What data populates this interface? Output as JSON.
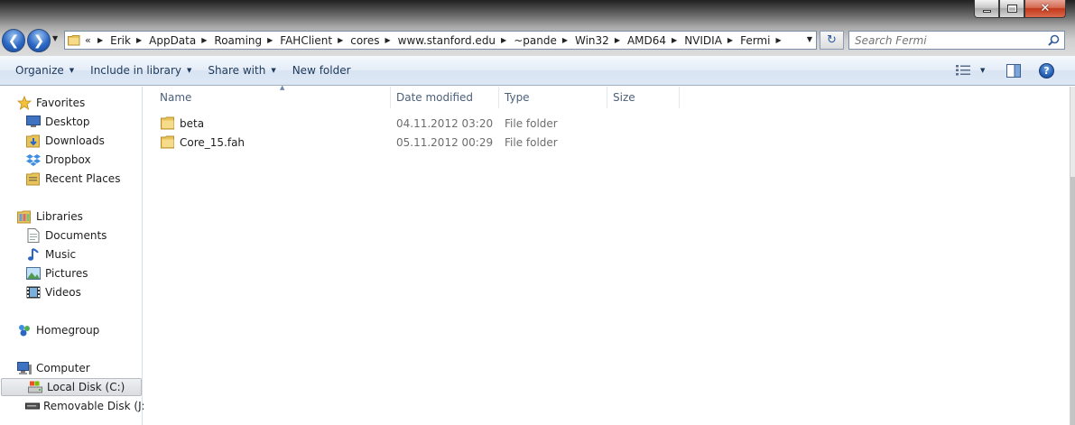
{
  "window": {
    "caption_buttons": {
      "minimize_icon": "minimize-icon",
      "maximize_icon": "maximize-icon",
      "close_icon": "close-icon",
      "close_glyph": "✕"
    }
  },
  "navigation": {
    "back_glyph": "❮",
    "forward_glyph": "❯",
    "history_glyph": "▼"
  },
  "address_bar": {
    "overflow_glyph": "«",
    "separator_glyph": "▶",
    "breadcrumbs": [
      "Erik",
      "AppData",
      "Roaming",
      "FAHClient",
      "cores",
      "www.stanford.edu",
      "~pande",
      "Win32",
      "AMD64",
      "NVIDIA",
      "Fermi"
    ],
    "dropdown_glyph": "▼",
    "refresh_glyph": "↻"
  },
  "search": {
    "placeholder": "Search Fermi"
  },
  "command_bar": {
    "organize": "Organize",
    "include_in_library": "Include in library",
    "share_with": "Share with",
    "new_folder": "New folder",
    "caret_glyph": "▼",
    "help_glyph": "?"
  },
  "nav_pane": {
    "favorites": {
      "label": "Favorites",
      "items": [
        "Desktop",
        "Downloads",
        "Dropbox",
        "Recent Places"
      ]
    },
    "libraries": {
      "label": "Libraries",
      "items": [
        "Documents",
        "Music",
        "Pictures",
        "Videos"
      ]
    },
    "homegroup": {
      "label": "Homegroup"
    },
    "computer": {
      "label": "Computer",
      "items": [
        "Local Disk (C:)",
        "Removable Disk (J:)"
      ],
      "selected": "Local Disk (C:)"
    }
  },
  "file_list": {
    "columns": [
      "Name",
      "Date modified",
      "Type",
      "Size"
    ],
    "sort_glyph": "▲",
    "rows": [
      {
        "name": "beta",
        "date_modified": "04.11.2012 03:20",
        "type": "File folder",
        "size": ""
      },
      {
        "name": "Core_15.fah",
        "date_modified": "05.11.2012 00:29",
        "type": "File folder",
        "size": ""
      }
    ]
  },
  "colors": {
    "accent": "#1e395b",
    "selection": "#dadde1",
    "folder": "#e8c35a"
  }
}
